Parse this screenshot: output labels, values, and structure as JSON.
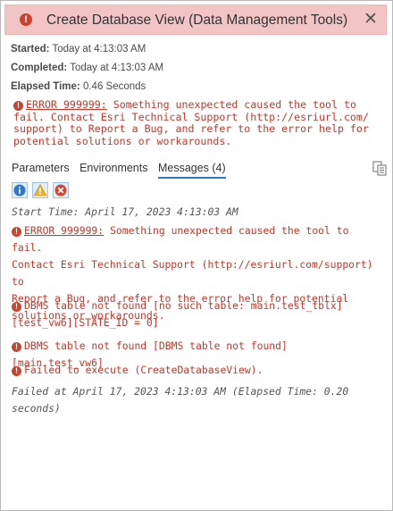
{
  "window": {
    "title": "Create Database View (Data Management Tools)",
    "close_label": "✕",
    "title_icon": "error-icon"
  },
  "meta": {
    "started_label": "Started:",
    "started_value": "Today at 4:13:03 AM",
    "completed_label": "Completed:",
    "completed_value": "Today at 4:13:03 AM",
    "elapsed_label": "Elapsed Time:",
    "elapsed_value": "0.46 Seconds"
  },
  "summary_error": {
    "code": "ERROR 999999:",
    "line1": " Something unexpected caused the tool to",
    "line2": "fail. Contact Esri Technical Support (http://esriurl.com/",
    "line3": "support) to Report a Bug, and refer to the error help for",
    "line4": "potential solutions or workarounds."
  },
  "tabs": [
    {
      "label": "Parameters"
    },
    {
      "label": "Environments"
    },
    {
      "label": "Messages (4)"
    }
  ],
  "filters": {
    "info": "info-filter-icon",
    "warning": "warning-filter-icon",
    "error": "error-filter-icon"
  },
  "messages": {
    "start_time": "Start Time: April 17, 2023 4:13:03 AM",
    "err1_code": "ERROR 999999:",
    "err1_line1": " Something unexpected caused the tool to fail.",
    "err1_line2": "Contact Esri Technical Support (http://esriurl.com/support) to",
    "err1_line3": "Report a Bug, and refer to the error help for potential",
    "err1_line4": "solutions or workarounds.",
    "err2_line1": "DBMS table not found [no such table: main.test_tblx]",
    "err2_line2": "[test_vw6][STATE_ID = 0]",
    "err3": "DBMS table not found [DBMS table not found] [main.test_vw6]",
    "err4": "Failed to execute (CreateDatabaseView).",
    "failed_line1": "Failed at April 17, 2023 4:13:03 AM (Elapsed Time: 0.20",
    "failed_line2": "seconds)"
  },
  "colors": {
    "title_bg": "#f3c4c4",
    "error": "#c0392b",
    "tab_accent": "#2e79c7"
  }
}
